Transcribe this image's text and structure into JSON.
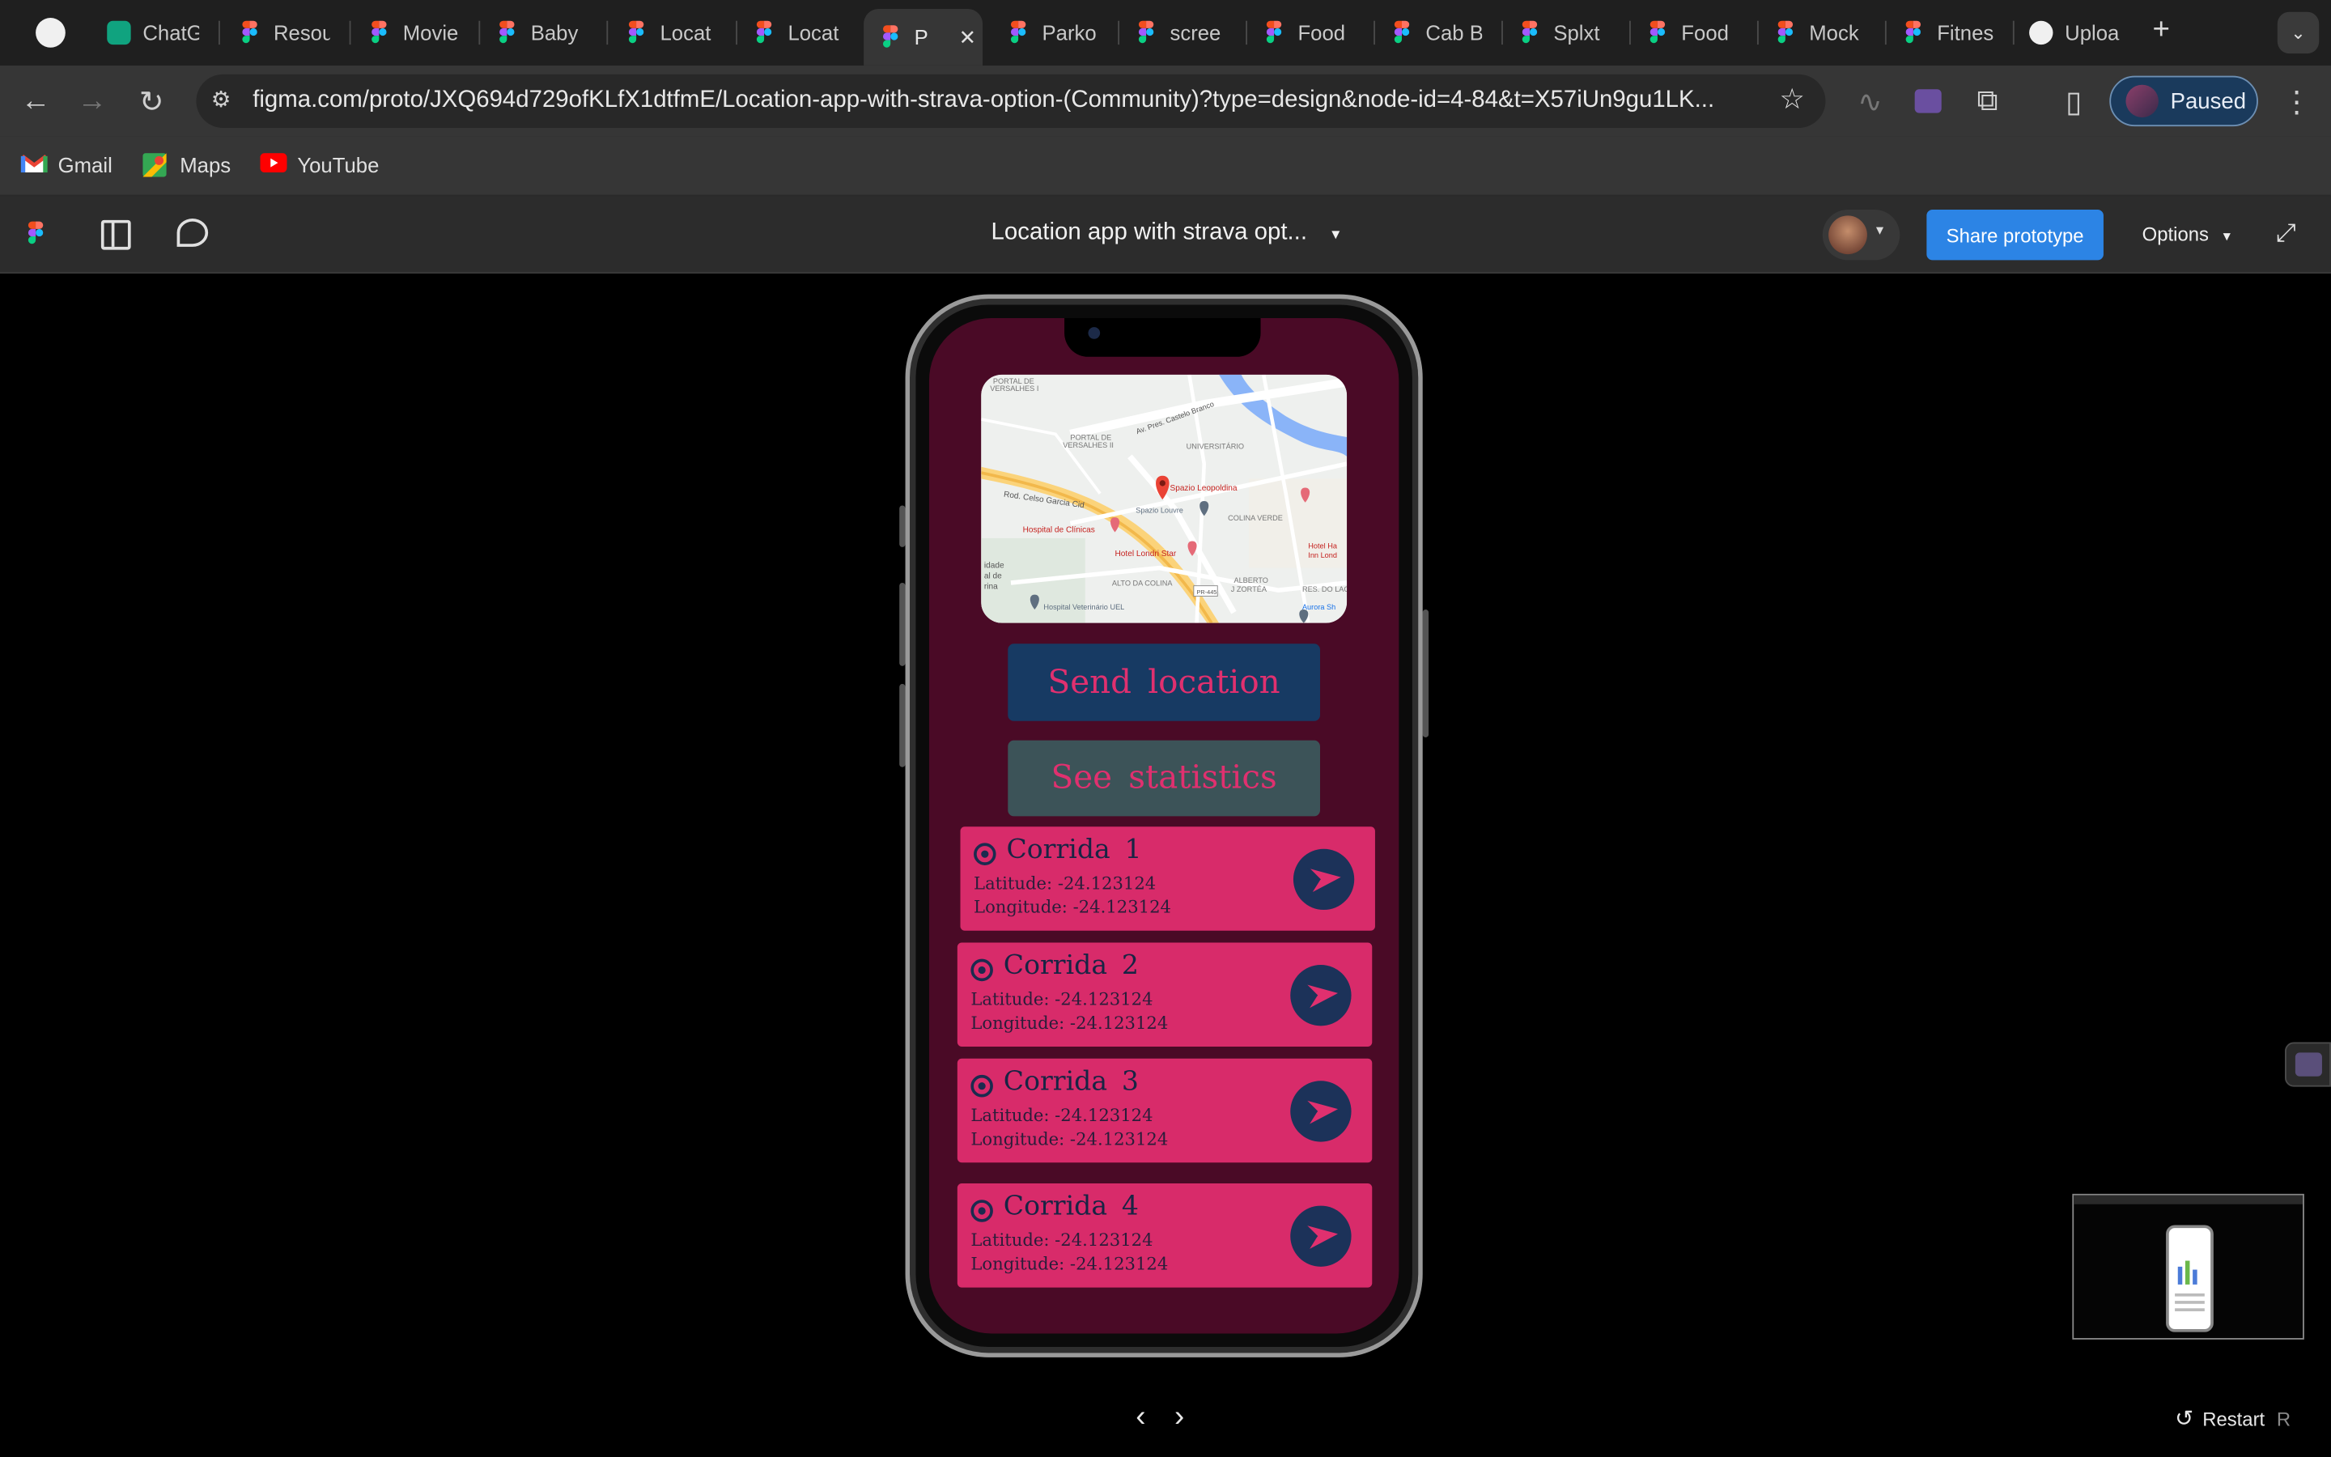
{
  "browser": {
    "tabs": [
      {
        "label": "",
        "icon": "vscode-like-icon"
      },
      {
        "label": "ChatG",
        "icon": "chatgpt-icon"
      },
      {
        "label": "Resou",
        "icon": "figma-icon"
      },
      {
        "label": "Movie",
        "icon": "figma-icon"
      },
      {
        "label": "Baby",
        "icon": "figma-icon"
      },
      {
        "label": "Locat",
        "icon": "figma-icon"
      },
      {
        "label": "Locat",
        "icon": "figma-icon"
      },
      {
        "label": "P",
        "icon": "figma-icon"
      },
      {
        "label": "Parko",
        "icon": "figma-icon"
      },
      {
        "label": "scree",
        "icon": "figma-icon"
      },
      {
        "label": "Food",
        "icon": "figma-icon"
      },
      {
        "label": "Cab B",
        "icon": "figma-icon"
      },
      {
        "label": "Splxt",
        "icon": "figma-icon"
      },
      {
        "label": "Food",
        "icon": "figma-icon"
      },
      {
        "label": "Mock",
        "icon": "figma-icon"
      },
      {
        "label": "Fitnes",
        "icon": "figma-icon"
      },
      {
        "label": "Uploa",
        "icon": "github-icon"
      }
    ],
    "url": "figma.com/proto/JXQ694d729ofKLfX1dtfmE/Location-app-with-strava-option-(Community)?type=design&node-id=4-84&t=X57iUn9gu1LK...",
    "profile_label": "Paused",
    "bookmarks": [
      {
        "label": "Gmail"
      },
      {
        "label": "Maps"
      },
      {
        "label": "YouTube"
      }
    ]
  },
  "figma": {
    "file_title": "Location app with strava opt...",
    "share_label": "Share prototype",
    "options_label": "Options",
    "restart_label": "Restart",
    "restart_shortcut": "R"
  },
  "app": {
    "send_label": "Send location",
    "stats_label": "See statistics",
    "runs": [
      {
        "title": "Corrida  1",
        "latitude": "Latitude:  -24.123124",
        "longitude": "Longitude:  -24.123124"
      },
      {
        "title": "Corrida  2",
        "latitude": "Latitude:  -24.123124",
        "longitude": "Longitude:  -24.123124"
      },
      {
        "title": "Corrida  3",
        "latitude": "Latitude:  -24.123124",
        "longitude": "Longitude:  -24.123124"
      },
      {
        "title": "Corrida  4",
        "latitude": "Latitude:  -24.123124",
        "longitude": "Longitude:  -24.123124"
      }
    ],
    "map": {
      "labels": [
        "PORTAL DE VERSALHES I",
        "PORTAL DE VERSALHES II",
        "UNIVERSITÁRIO",
        "Av. Pres. Castelo Branco",
        "Spazio Leopoldina",
        "Spazio Louvre",
        "COLINA VERDE",
        "Rod. Celso Garcia Cid",
        "Hospital de Clínicas",
        "Hotel Londri Star",
        "ALTO DA COLINA",
        "ALBERTO J ZORTÉA",
        "Hospital Veterinário UEL",
        "Aurora Sh",
        "Hotel Ha Inn Lond",
        "RES. DO LAG",
        "idade al de rina",
        "PR-445"
      ]
    }
  },
  "colors": {
    "screen_bg": "#4a0a26",
    "card_bg": "#d82b6a",
    "send_bg": "#173a63",
    "stats_bg": "#3c5358",
    "button_text": "#e0306f",
    "icon_circle": "#1c3259",
    "share_blue": "#2c84e5"
  }
}
